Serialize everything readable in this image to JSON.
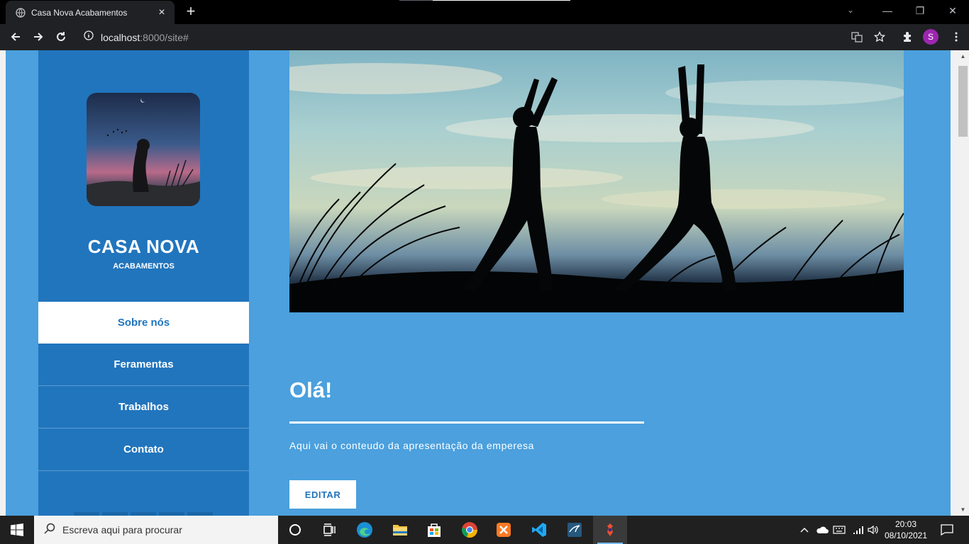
{
  "browser": {
    "tab_title": "Casa Nova Acabamentos",
    "tab_close": "×",
    "new_tab": "+",
    "url_host": "localhost",
    "url_rest": ":8000/site#",
    "profile_initial": "S",
    "window_controls": {
      "minimize": "—",
      "restore": "❐",
      "close": "✕",
      "tab_search": "⌄"
    }
  },
  "site": {
    "brand_name": "CASA NOVA",
    "brand_subtitle": "ACABAMENTOS",
    "nav": [
      {
        "label": "Sobre nós",
        "active": true
      },
      {
        "label": "Feramentas"
      },
      {
        "label": "Trabalhos"
      },
      {
        "label": "Contato"
      }
    ],
    "heading": "Olá!",
    "description": "Aqui vai o conteudo da apresentação da emperesa",
    "edit_button": "EDITAR"
  },
  "taskbar": {
    "search_placeholder": "Escreva aqui para procurar",
    "time": "20:03",
    "date": "08/10/2021",
    "pinned_icons": [
      "cortana-icon",
      "task-view-icon",
      "edge-icon",
      "file-explorer-icon",
      "store-icon",
      "chrome-icon",
      "xampp-icon",
      "vscode-icon",
      "mysql-workbench-icon",
      "git-icon"
    ]
  },
  "colors": {
    "page_bg": "#4ba0dd",
    "sidebar_bg": "#2175bd",
    "accent": "#2175bd",
    "browser_chrome": "#202124",
    "taskbar_bg": "#202020"
  }
}
